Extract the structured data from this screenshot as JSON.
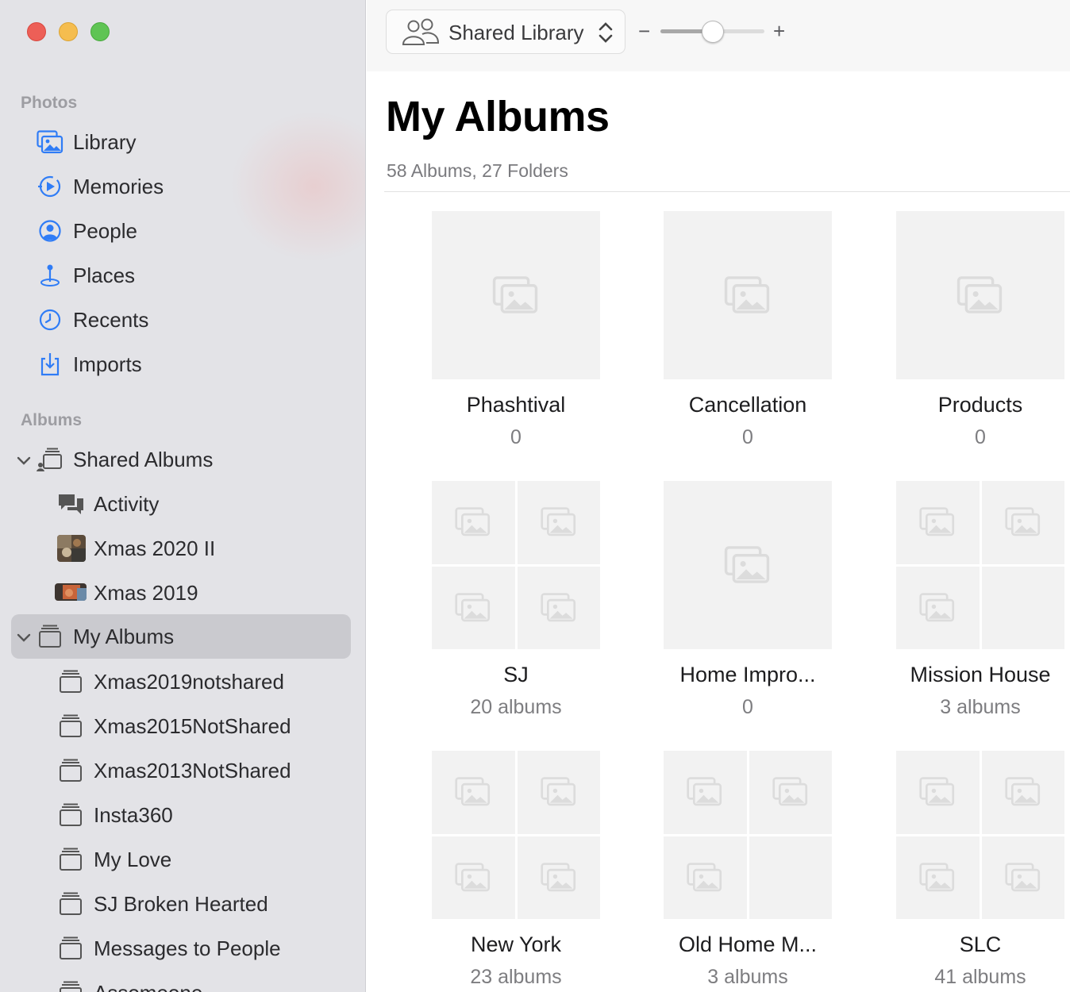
{
  "sidebar": {
    "photos_section": "Photos",
    "albums_section": "Albums",
    "items": [
      {
        "label": "Library",
        "icon": "library-icon"
      },
      {
        "label": "Memories",
        "icon": "memories-icon"
      },
      {
        "label": "People",
        "icon": "people-icon"
      },
      {
        "label": "Places",
        "icon": "places-icon"
      },
      {
        "label": "Recents",
        "icon": "recents-icon"
      },
      {
        "label": "Imports",
        "icon": "imports-icon"
      }
    ],
    "shared_albums": {
      "label": "Shared Albums",
      "children": [
        {
          "label": "Activity"
        },
        {
          "label": "Xmas 2020 II"
        },
        {
          "label": "Xmas 2019"
        }
      ]
    },
    "my_albums": {
      "label": "My Albums",
      "children": [
        {
          "label": "Xmas2019notshared"
        },
        {
          "label": "Xmas2015NotShared"
        },
        {
          "label": "Xmas2013NotShared"
        },
        {
          "label": "Insta360"
        },
        {
          "label": "My Love"
        },
        {
          "label": "SJ Broken Hearted"
        },
        {
          "label": "Messages to People"
        },
        {
          "label": "Assomeone"
        }
      ]
    }
  },
  "toolbar": {
    "library_selector": "Shared Library",
    "zoom_minus": "−",
    "zoom_plus": "+",
    "zoom_level": 0.5
  },
  "main": {
    "title": "My Albums",
    "subtitle": "58 Albums, 27 Folders",
    "albums": [
      {
        "name": "Phashtival",
        "count": "0",
        "kind": "album"
      },
      {
        "name": "Cancellation",
        "count": "0",
        "kind": "album"
      },
      {
        "name": "Products",
        "count": "0",
        "kind": "album"
      },
      {
        "name": "SJ",
        "count": "20 albums",
        "kind": "folder4"
      },
      {
        "name": "Home Impro...",
        "count": "0",
        "kind": "album"
      },
      {
        "name": "Mission House",
        "count": "3 albums",
        "kind": "folder3"
      },
      {
        "name": "New York",
        "count": "23 albums",
        "kind": "folder4"
      },
      {
        "name": "Old Home M...",
        "count": "3 albums",
        "kind": "folder3"
      },
      {
        "name": "SLC",
        "count": "41 albums",
        "kind": "folder4"
      }
    ]
  },
  "colors": {
    "accent": "#2f7cf6",
    "sidebar_bg": "#e3e3e7",
    "selected_bg": "#cacacf"
  }
}
